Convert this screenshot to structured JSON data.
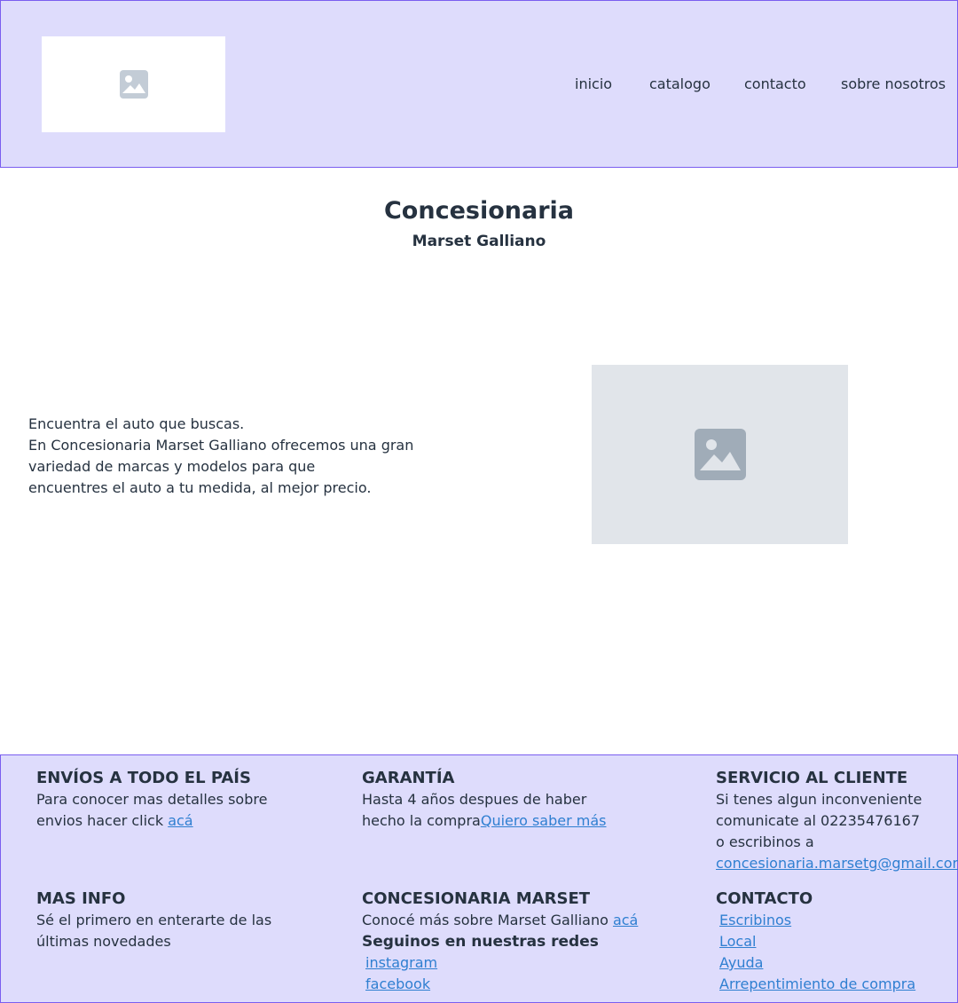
{
  "header": {
    "logo_icon": "image-placeholder-icon",
    "nav": [
      "inicio",
      "catalogo",
      "contacto",
      "sobre nosotros"
    ]
  },
  "hero": {
    "title": "Concesionaria",
    "subtitle": "Marset Galliano",
    "intro_lines": [
      "Encuentra el auto que buscas.",
      "En Concesionaria Marset Galliano ofrecemos una gran",
      "variedad de marcas y modelos para que",
      "encuentres el auto a tu medida, al mejor precio."
    ],
    "image_icon": "image-placeholder-icon"
  },
  "footer": {
    "envios": {
      "title": "ENVÍOS A TODO EL PAÍS",
      "line1": "Para conocer mas detalles sobre",
      "line2": "envios hacer click ",
      "link": "acá"
    },
    "garantia": {
      "title": "GARANTÍA",
      "line1": "Hasta 4 años despues de haber",
      "line2": "hecho la compra",
      "link": "Quiero saber más"
    },
    "servicio": {
      "title": "SERVICIO AL CLIENTE",
      "line1": "Si tenes algun inconveniente",
      "line2": "comunicate al 02235476167",
      "line3": "o escribinos a",
      "email": "concesionaria.marsetg@gmail.com"
    },
    "masinfo": {
      "title": "MAS INFO",
      "line1": "Sé el primero en enterarte de las",
      "line2": "últimas novedades"
    },
    "marset": {
      "title": "CONCESIONARIA MARSET",
      "line1": "Conocé más sobre Marset Galliano ",
      "link": "acá",
      "social_title": "Seguinos en nuestras redes",
      "social": [
        "instagram",
        "facebook"
      ]
    },
    "contacto": {
      "title": "CONTACTO",
      "links": [
        "Escribinos",
        "Local",
        "Ayuda",
        "Arrepentimiento de compra"
      ]
    }
  },
  "colors": {
    "band": "#dedcfc",
    "border": "#7a5ef0",
    "text": "#263240",
    "link": "#2f7fd1",
    "placeholder": "#e1e5ea"
  }
}
